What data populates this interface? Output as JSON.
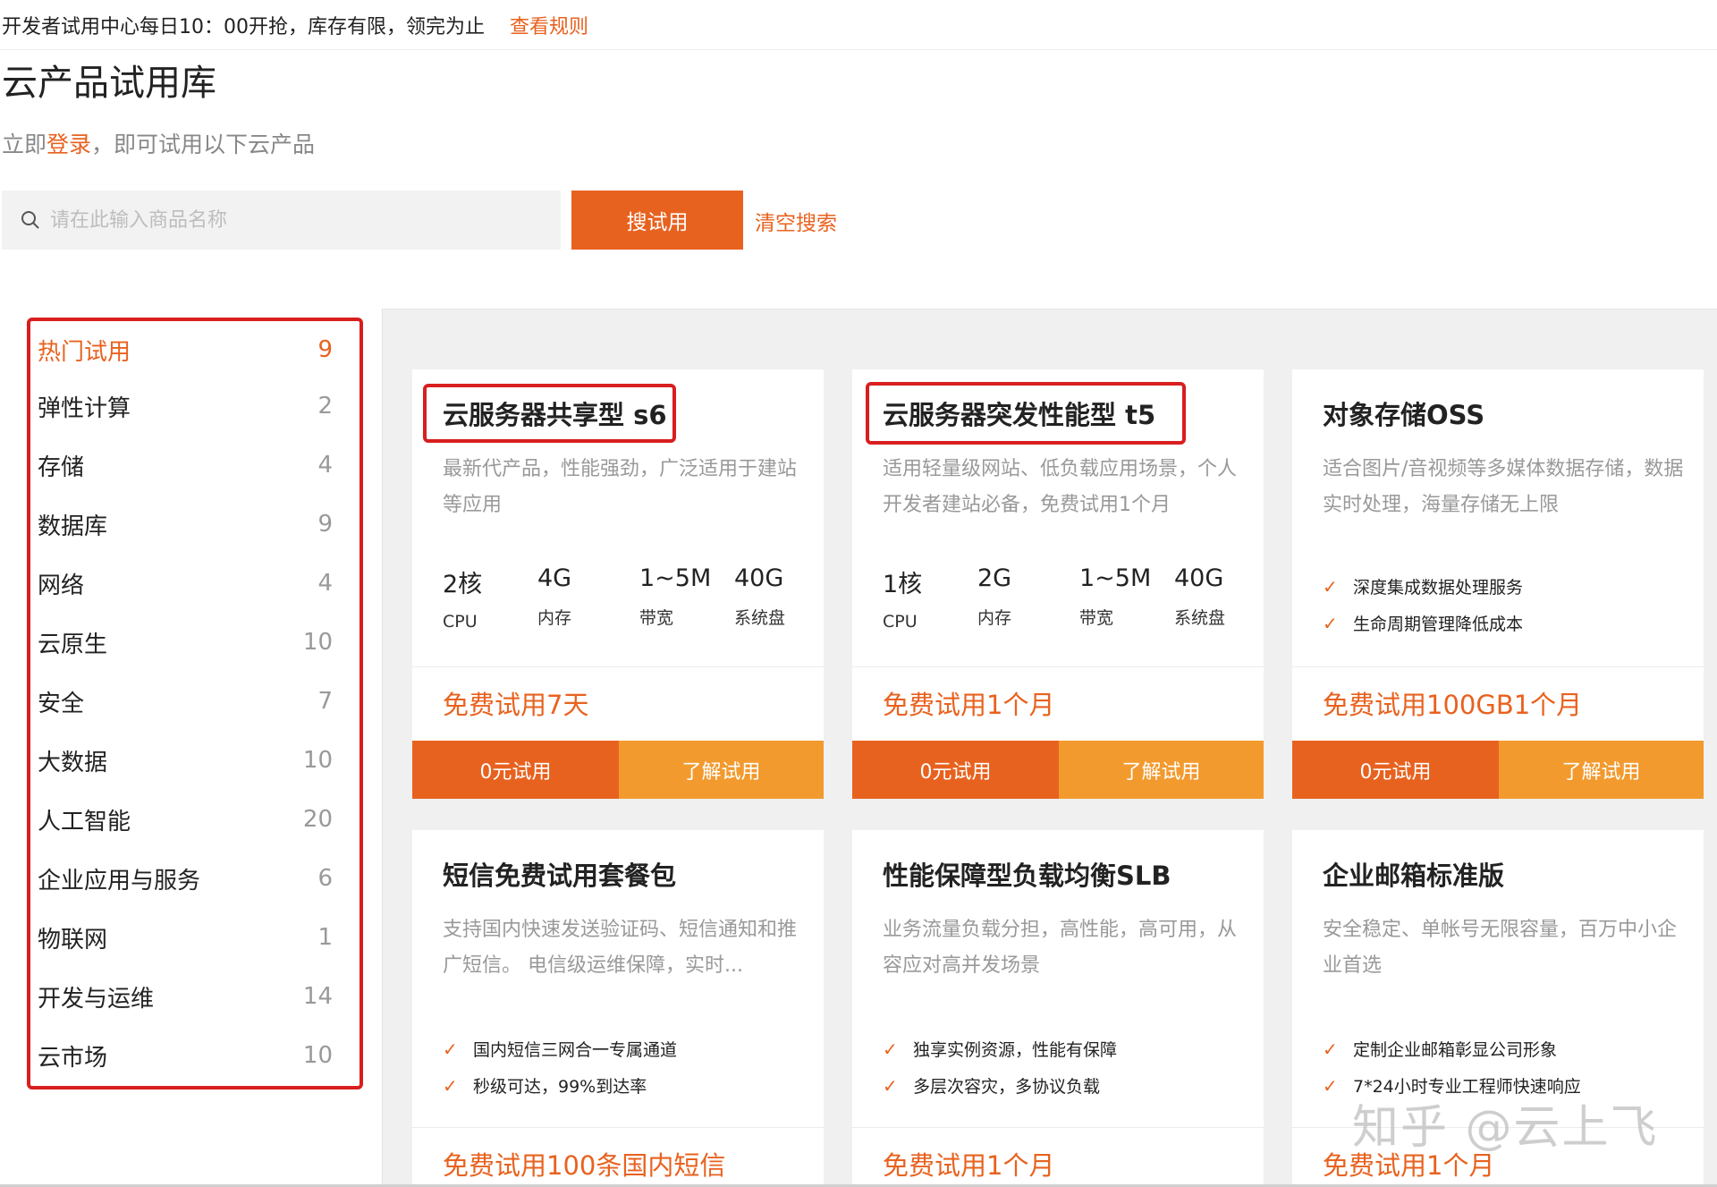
{
  "notice": {
    "text": "开发者试用中心每日10：00开抢，库存有限，领完为止",
    "rule_link": "查看规则"
  },
  "page_title": "云产品试用库",
  "login_line": {
    "prefix": "立即",
    "login_link": "登录",
    "suffix": "，即可试用以下云产品"
  },
  "search": {
    "placeholder": "请在此输入商品名称",
    "button_label": "搜试用",
    "clear_label": "清空搜索"
  },
  "categories": [
    {
      "label": "热门试用",
      "count": "9",
      "active": true
    },
    {
      "label": "弹性计算",
      "count": "2"
    },
    {
      "label": "存储",
      "count": "4"
    },
    {
      "label": "数据库",
      "count": "9"
    },
    {
      "label": "网络",
      "count": "4"
    },
    {
      "label": "云原生",
      "count": "10"
    },
    {
      "label": "安全",
      "count": "7"
    },
    {
      "label": "大数据",
      "count": "10"
    },
    {
      "label": "人工智能",
      "count": "20"
    },
    {
      "label": "企业应用与服务",
      "count": "6"
    },
    {
      "label": "物联网",
      "count": "1"
    },
    {
      "label": "开发与运维",
      "count": "14"
    },
    {
      "label": "云市场",
      "count": "10"
    }
  ],
  "cards": [
    {
      "title": "云服务器共享型 s6",
      "desc": "最新代产品，性能强劲，广泛适用于建站等应用",
      "specs": [
        {
          "value": "2核",
          "label": "CPU"
        },
        {
          "value": "4G",
          "label": "内存"
        },
        {
          "value": "1~5M",
          "label": "带宽"
        },
        {
          "value": "40G",
          "label": "系统盘"
        }
      ],
      "trial": "免费试用7天",
      "btn_trial": "0元试用",
      "btn_learn": "了解试用"
    },
    {
      "title": "云服务器突发性能型 t5",
      "desc": "适用轻量级网站、低负载应用场景，个人开发者建站必备，免费试用1个月",
      "specs": [
        {
          "value": "1核",
          "label": "CPU"
        },
        {
          "value": "2G",
          "label": "内存"
        },
        {
          "value": "1~5M",
          "label": "带宽"
        },
        {
          "value": "40G",
          "label": "系统盘"
        }
      ],
      "trial": "免费试用1个月",
      "btn_trial": "0元试用",
      "btn_learn": "了解试用"
    },
    {
      "title": "对象存储OSS",
      "desc": "适合图片/音视频等多媒体数据存储，数据实时处理，海量存储无上限",
      "features": [
        "深度集成数据处理服务",
        "生命周期管理降低成本"
      ],
      "trial": "免费试用100GB1个月",
      "btn_trial": "0元试用",
      "btn_learn": "了解试用"
    },
    {
      "title": "短信免费试用套餐包",
      "desc": "支持国内快速发送验证码、短信通知和推广短信。 电信级运维保障，实时...",
      "features": [
        "国内短信三网合一专属通道",
        "秒级可达，99%到达率"
      ],
      "trial": "免费试用100条国内短信"
    },
    {
      "title": "性能保障型负载均衡SLB",
      "desc": "业务流量负载分担，高性能，高可用，从容应对高并发场景",
      "features": [
        "独享实例资源，性能有保障",
        "多层次容灾，多协议负载"
      ],
      "trial": "免费试用1个月"
    },
    {
      "title": "企业邮箱标准版",
      "desc": "安全稳定、单帐号无限容量，百万中小企业首选",
      "features": [
        "定制企业邮箱彰显公司形象",
        "7*24小时专业工程师快速响应"
      ],
      "trial": "免费试用1个月"
    }
  ],
  "watermark": "知乎 @云上飞",
  "colors": {
    "accent": "#e8621f",
    "accent_light": "#f39a2e",
    "highlight_box": "#d81e1e"
  }
}
